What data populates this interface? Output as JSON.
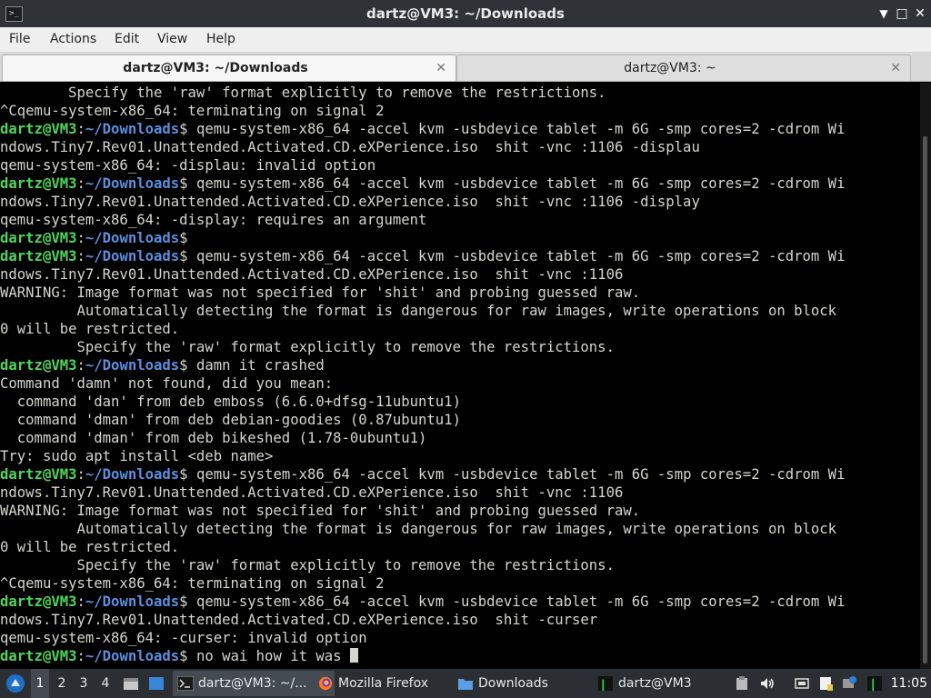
{
  "window": {
    "title": "dartz@VM3: ~/Downloads"
  },
  "menu": [
    "File",
    "Actions",
    "Edit",
    "View",
    "Help"
  ],
  "tabs": [
    {
      "label": "dartz@VM3: ~/Downloads",
      "active": true
    },
    {
      "label": "dartz@VM3: ~",
      "active": false
    }
  ],
  "prompt": {
    "user": "dartz@VM3",
    "path": "~/Downloads"
  },
  "terminal": {
    "lines": [
      {
        "text": "        Specify the 'raw' format explicitly to remove the restrictions."
      },
      {
        "text": "^Cqemu-system-x86_64: terminating on signal 2"
      },
      {
        "prompt": true,
        "text": "qemu-system-x86_64 -accel kvm -usbdevice tablet -m 6G -smp cores=2 -cdrom Wi"
      },
      {
        "text": "ndows.Tiny7.Rev01.Unattended.Activated.CD.eXPerience.iso  shit -vnc :1106 -displau"
      },
      {
        "text": "qemu-system-x86_64: -displau: invalid option"
      },
      {
        "prompt": true,
        "text": "qemu-system-x86_64 -accel kvm -usbdevice tablet -m 6G -smp cores=2 -cdrom Wi"
      },
      {
        "text": "ndows.Tiny7.Rev01.Unattended.Activated.CD.eXPerience.iso  shit -vnc :1106 -display"
      },
      {
        "text": "qemu-system-x86_64: -display: requires an argument"
      },
      {
        "prompt": true,
        "text": ""
      },
      {
        "prompt": true,
        "text": "qemu-system-x86_64 -accel kvm -usbdevice tablet -m 6G -smp cores=2 -cdrom Wi"
      },
      {
        "text": "ndows.Tiny7.Rev01.Unattended.Activated.CD.eXPerience.iso  shit -vnc :1106"
      },
      {
        "text": "WARNING: Image format was not specified for 'shit' and probing guessed raw."
      },
      {
        "text": "         Automatically detecting the format is dangerous for raw images, write operations on block"
      },
      {
        "text": "0 will be restricted."
      },
      {
        "text": "         Specify the 'raw' format explicitly to remove the restrictions."
      },
      {
        "prompt": true,
        "text": "damn it crashed"
      },
      {
        "text": "Command 'damn' not found, did you mean:"
      },
      {
        "text": "  command 'dan' from deb emboss (6.6.0+dfsg-11ubuntu1)"
      },
      {
        "text": "  command 'dman' from deb debian-goodies (0.87ubuntu1)"
      },
      {
        "text": "  command 'dman' from deb bikeshed (1.78-0ubuntu1)"
      },
      {
        "text": "Try: sudo apt install <deb name>"
      },
      {
        "prompt": true,
        "text": "qemu-system-x86_64 -accel kvm -usbdevice tablet -m 6G -smp cores=2 -cdrom Wi"
      },
      {
        "text": "ndows.Tiny7.Rev01.Unattended.Activated.CD.eXPerience.iso  shit -vnc :1106"
      },
      {
        "text": "WARNING: Image format was not specified for 'shit' and probing guessed raw."
      },
      {
        "text": "         Automatically detecting the format is dangerous for raw images, write operations on block"
      },
      {
        "text": "0 will be restricted."
      },
      {
        "text": "         Specify the 'raw' format explicitly to remove the restrictions."
      },
      {
        "text": "^Cqemu-system-x86_64: terminating on signal 2"
      },
      {
        "prompt": true,
        "text": "qemu-system-x86_64 -accel kvm -usbdevice tablet -m 6G -smp cores=2 -cdrom Wi"
      },
      {
        "text": "ndows.Tiny7.Rev01.Unattended.Activated.CD.eXPerience.iso  shit -curser"
      },
      {
        "text": "qemu-system-x86_64: -curser: invalid option"
      },
      {
        "prompt": true,
        "text": "no wai how it was ",
        "cursor": true
      }
    ]
  },
  "taskbar": {
    "workspaces": [
      "1",
      "2",
      "3",
      "4"
    ],
    "active_workspace": "1",
    "tasks": [
      {
        "label": "dartz@VM3: ~/...",
        "icon": "terminal-icon",
        "active": true
      },
      {
        "label": "Mozilla Firefox",
        "icon": "firefox-icon",
        "active": false
      },
      {
        "label": "Downloads",
        "icon": "folder-icon",
        "active": false
      },
      {
        "label": "dartz@VM3",
        "icon": "cpu-monitor-icon",
        "active": false
      }
    ],
    "clock": "11:05"
  },
  "colors": {
    "prompt_user": "#4fd65a",
    "prompt_path": "#5b8fde",
    "terminal_fg": "#d3d7cf",
    "terminal_bg": "#000000"
  }
}
